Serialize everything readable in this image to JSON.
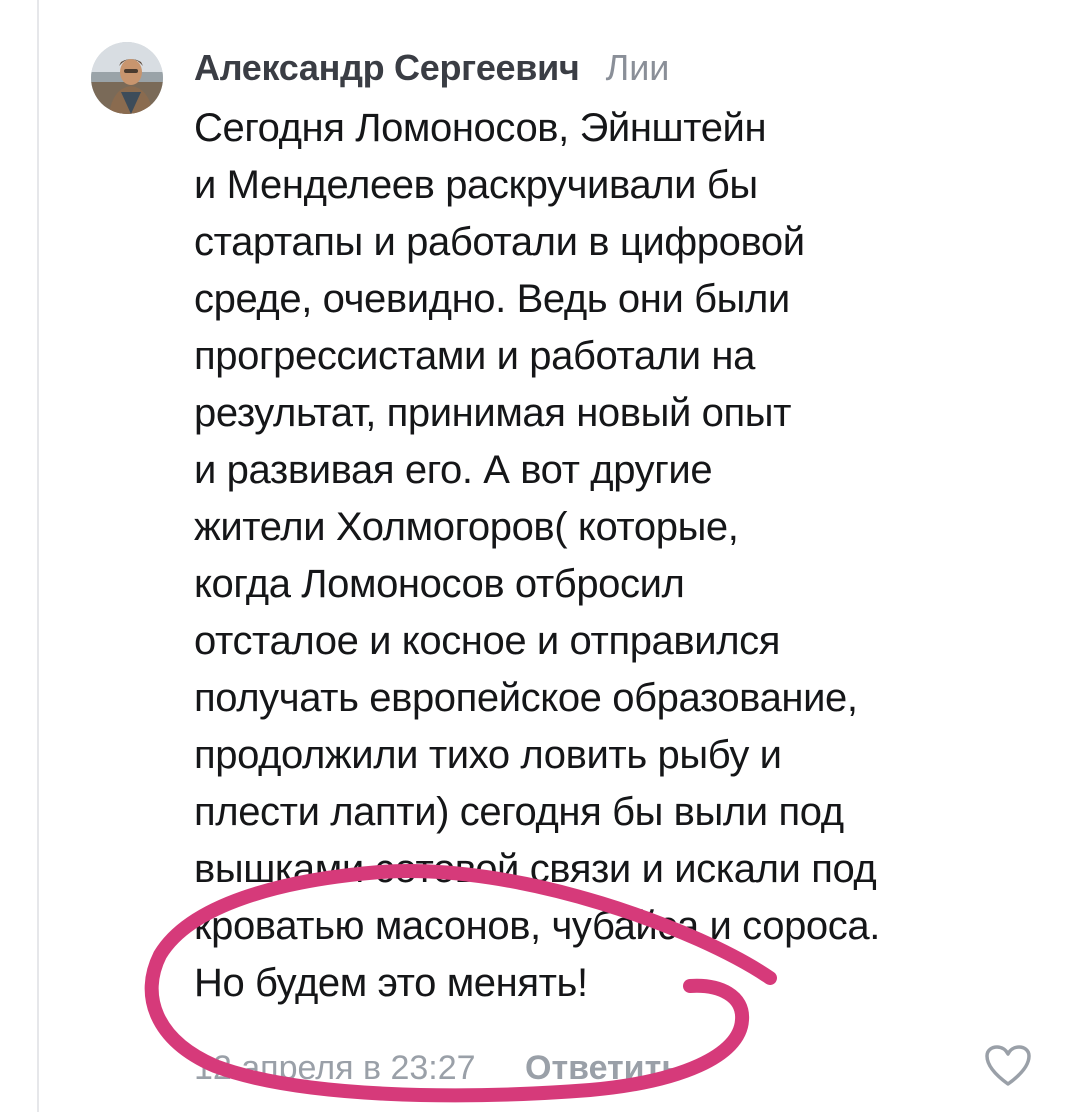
{
  "comment": {
    "author": "Александр Сергеевич",
    "reply_to": "Лии",
    "lines": [
      "Сегодня Ломоносов, Эйнштейн",
      "и Менделеев раскручивали бы",
      "стартапы и работали в цифровой",
      "среде, очевидно. Ведь они были",
      "прогрессистами и работали на",
      "результат, принимая новый опыт",
      "и развивая его. А вот другие",
      "жители Холмогоров( которые,",
      "когда Ломоносов отбросил",
      "отсталое и косное и отправился",
      "получать европейское образование,",
      "продолжили тихо ловить рыбу и",
      "плести лапти) сегодня бы выли под",
      "вышками сотовой связи и искали под",
      "кроватью масонов, чубайса и сороса.",
      "Но будем это менять!"
    ],
    "timestamp": "12 апреля в 23:27",
    "reply_label": "Ответить",
    "like_icon": "heart-outline-icon"
  },
  "annotation": {
    "shape": "hand-drawn ellipse",
    "color": "#d63a7a"
  }
}
